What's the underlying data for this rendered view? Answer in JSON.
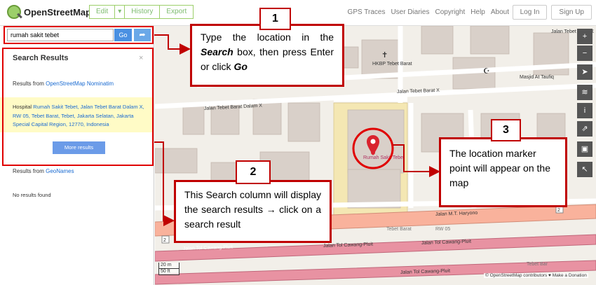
{
  "header": {
    "logo_text": "OpenStreetMap",
    "edit_label": "Edit",
    "caret": "▾",
    "history_label": "History",
    "export_label": "Export",
    "nav": [
      "GPS Traces",
      "User Diaries",
      "Copyright",
      "Help",
      "About"
    ],
    "login_label": "Log In",
    "signup_label": "Sign Up"
  },
  "search": {
    "query": "rumah sakit tebet",
    "go_label": "Go",
    "directions_icon": "➦"
  },
  "results": {
    "title": "Search Results",
    "close": "×",
    "from_label_1": "Results from ",
    "source_1": "OpenStreetMap Nominatim",
    "hit_type": "Hospital ",
    "hit_text": "Rumah Sakit Tebet, Jalan Tebet Barat Dalam X, RW 05, Tebet Barat, Tebet, Jakarta Selatan, Jakarta Special Capital Region, 12770, Indonesia",
    "more_label": "More results",
    "from_label_2": "Results from ",
    "source_2": "GeoNames",
    "no_results": "No results found"
  },
  "map": {
    "road_labels": {
      "tebet_barat_dalam_x_top": "Jalan Tebet Barat X",
      "tebet_barat_x": "Jalan Tebet Barat X",
      "tebet_barat_dalam_x": "Jalan Tebet Barat Dalam X",
      "mt_haryono": "Jalan M.T. Haryono",
      "tol_1": "Jalan Tol Cawang-Pluit",
      "tol_2": "Jalan Tol Cawang-Pluit",
      "tol_3": "Jalan Tol Cawang-Pluit",
      "tol_4": "Jalan Tol Cawang-Pluit",
      "tebet_barat": "Tebet Barat",
      "rw05": "RW 05",
      "tebet_barat_right": "Tebet Bar"
    },
    "poi": {
      "church": "HKBP Tebet Barat",
      "mosque": "Masjid At Taufiq",
      "hospital": "Rumah Sakit Tebet"
    },
    "shields": [
      "2",
      "2"
    ],
    "scale": [
      "20 m",
      "50 ft"
    ],
    "attribution": "© OpenStreetMap contributors ♥ Make a Donation",
    "controls": [
      "+",
      "−",
      "➤",
      "≋",
      "i",
      "⇗",
      "▣",
      "↖"
    ]
  },
  "callouts": {
    "c1_number": "1",
    "c1_text_a": "Type the location in the ",
    "c1_text_b": "Search",
    "c1_text_c": " box, then press Enter or click ",
    "c1_text_d": "Go",
    "c2_number": "2",
    "c2_text": "This Search column will display the search results → click on a search result",
    "c3_number": "3",
    "c3_text": "The location marker point will appear on the map"
  },
  "colors": {
    "annotation_red": "#c00000",
    "osm_green": "#7ebc6f",
    "go_blue": "#4a90e2",
    "result_highlight": "#fffbc6",
    "trunk_road": "#f9b29c"
  }
}
